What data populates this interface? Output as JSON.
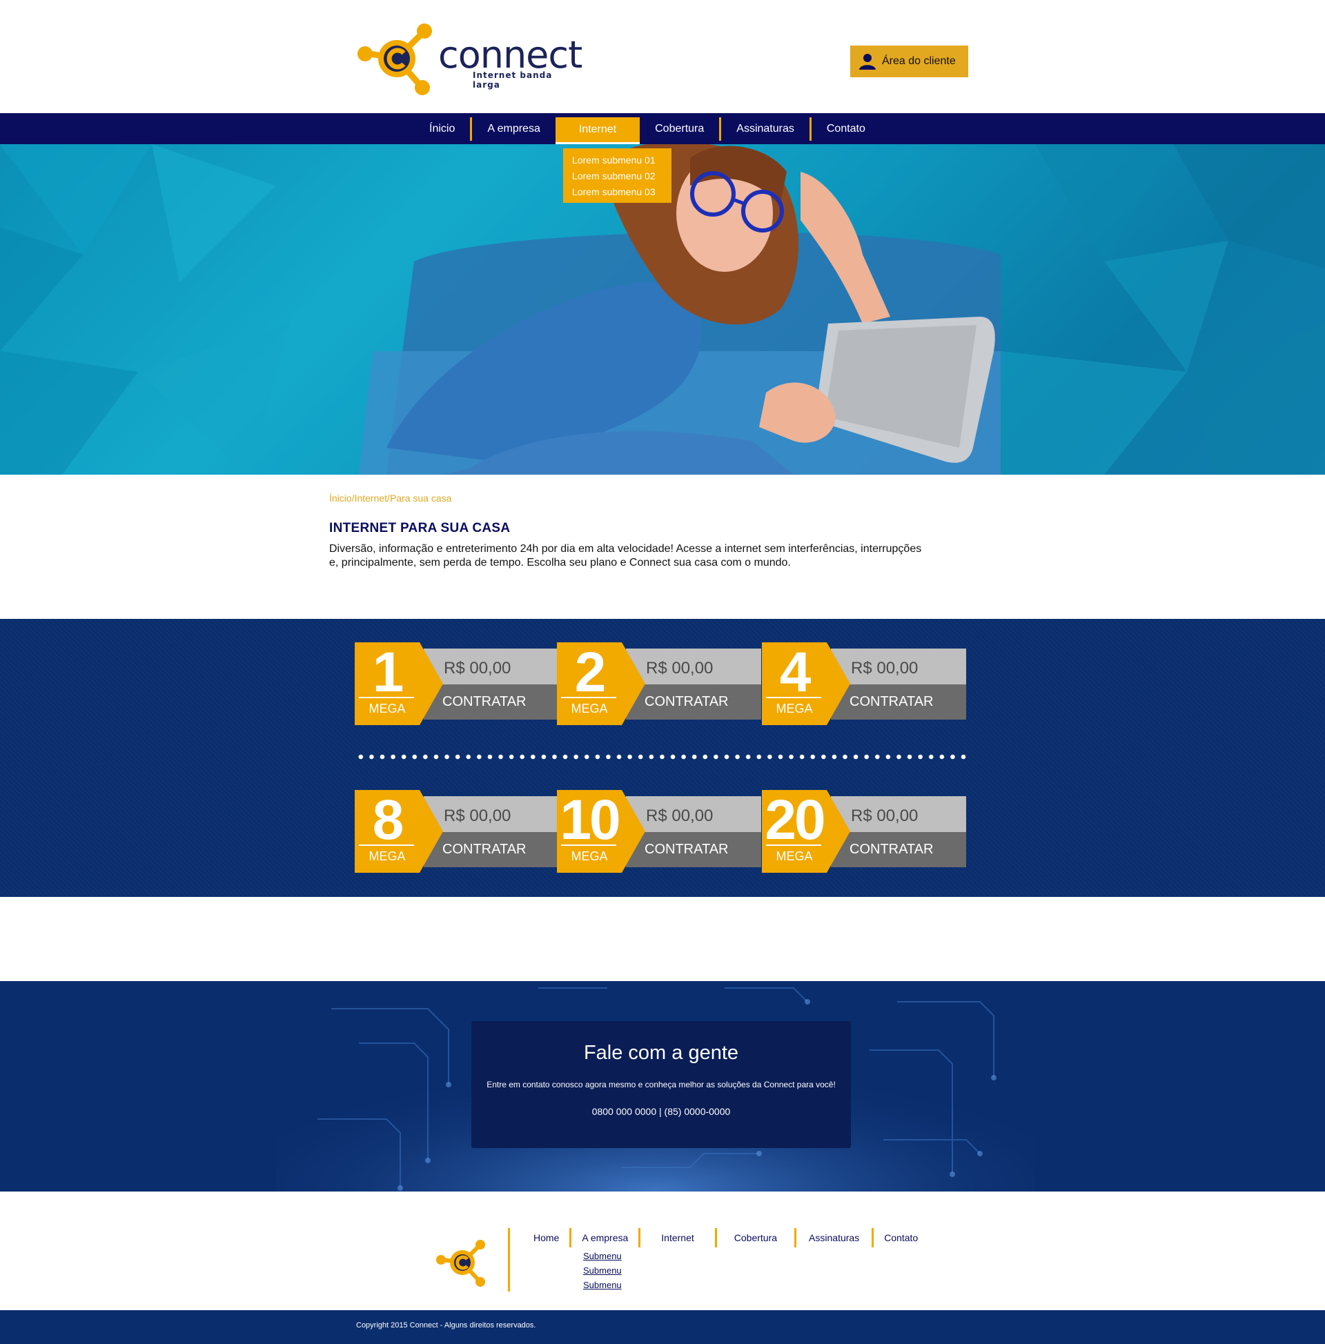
{
  "header": {
    "logo_word": "connect",
    "logo_tagline": "Internet banda larga",
    "client_area_label": "Área do cliente"
  },
  "nav": {
    "items": [
      {
        "label": "Ínicio"
      },
      {
        "label": "A empresa"
      },
      {
        "label": "Internet",
        "active": true
      },
      {
        "label": "Cobertura"
      },
      {
        "label": "Assinaturas"
      },
      {
        "label": "Contato"
      }
    ],
    "dropdown": [
      "Lorem submenu 01",
      "Lorem submenu 02",
      "Lorem submenu 03"
    ]
  },
  "content": {
    "breadcrumb": "Ínicio/Internet/Para sua casa",
    "title": "INTERNET PARA SUA CASA",
    "description": "Diversão, informação e entreterimento 24h por dia em alta velocidade! Acesse a internet sem interferências, interrupções e, principalmente, sem perda de tempo. Escolha seu plano e Connect sua casa com o mundo."
  },
  "plans": {
    "unit": "MEGA",
    "cta": "CONTRATAR",
    "items": [
      {
        "speed": "1",
        "price": "R$ 00,00"
      },
      {
        "speed": "2",
        "price": "R$ 00,00"
      },
      {
        "speed": "4",
        "price": "R$ 00,00"
      },
      {
        "speed": "8",
        "price": "R$ 00,00"
      },
      {
        "speed": "10",
        "price": "R$ 00,00"
      },
      {
        "speed": "20",
        "price": "R$ 00,00"
      }
    ]
  },
  "contact": {
    "title": "Fale com a gente",
    "text": "Entre em contato conosco agora mesmo e conheça melhor as soluções da Connect para você!",
    "phones": "0800 000 0000 | (85) 0000-0000"
  },
  "footer": {
    "items": [
      "Home",
      "A empresa",
      "Internet",
      "Cobertura",
      "Assinaturas",
      "Contato"
    ],
    "submenu": [
      "Submenu",
      "Submenu",
      "Submenu"
    ],
    "copyright": "Copyright 2015 Connect - Alguns direitos reservados."
  },
  "colors": {
    "navy": "#0a0d5e",
    "blue": "#0a2d6d",
    "accent": "#f2a900",
    "gold_button": "#e2a820"
  },
  "icons": [
    "connect-logo-icon",
    "user-icon"
  ]
}
